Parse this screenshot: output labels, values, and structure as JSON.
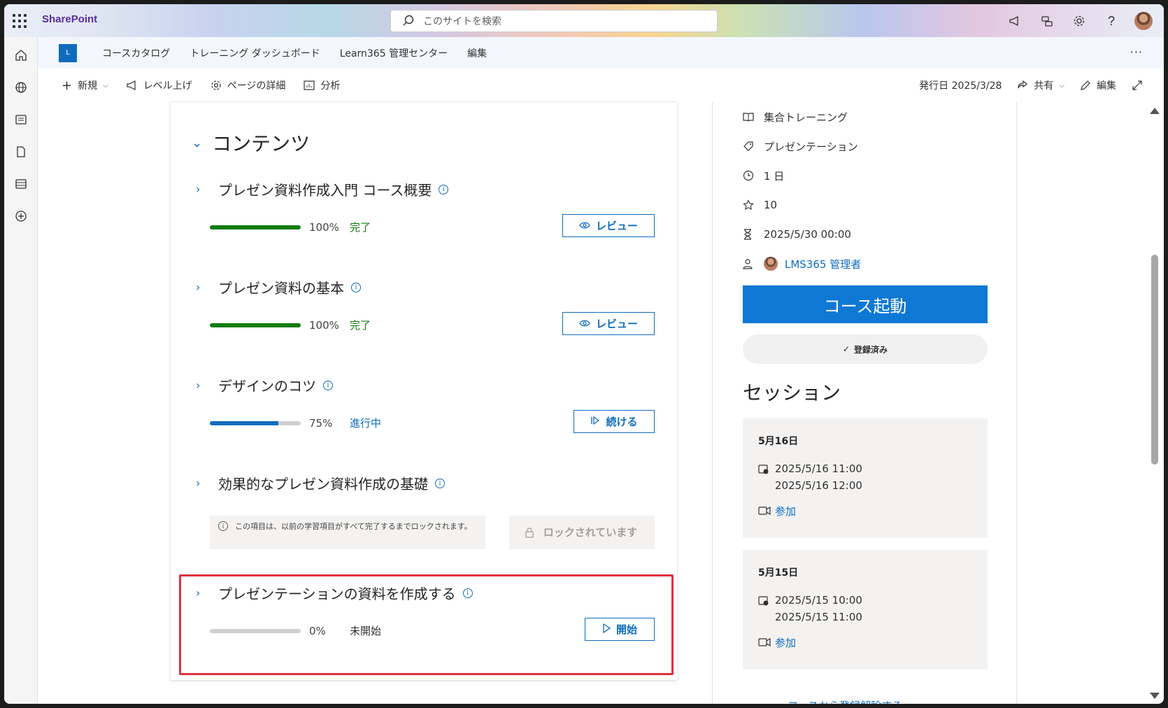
{
  "app": {
    "brand": "SharePoint",
    "search_placeholder": "このサイトを検索",
    "site_logo": "L"
  },
  "hub_nav": {
    "items": [
      "コースカタログ",
      "トレーニング ダッシュボード",
      "Learn365 管理センター",
      "編集"
    ],
    "more": "···"
  },
  "command_bar": {
    "new": "新規",
    "promote": "レベル上げ",
    "page_details": "ページの詳細",
    "analytics": "分析",
    "published": "発行日 2025/3/28",
    "share": "共有",
    "edit": "編集"
  },
  "contents": {
    "title": "コンテンツ",
    "modules": [
      {
        "title": "プレゼン資料作成入門 コース概要",
        "percent": "100%",
        "status": "完了",
        "progress": 1.0,
        "action": "レビュー",
        "status_color": "#107c10",
        "bar_color": "#107c10"
      },
      {
        "title": "プレゼン資料の基本",
        "percent": "100%",
        "status": "完了",
        "progress": 1.0,
        "action": "レビュー",
        "status_color": "#107c10",
        "bar_color": "#107c10"
      },
      {
        "title": "デザインのコツ",
        "percent": "75%",
        "status": "進行中",
        "progress": 0.75,
        "action": "続ける",
        "status_color": "#0f6cbd",
        "bar_color": "#0f6cbd"
      },
      {
        "title": "効果的なプレゼン資料作成の基礎",
        "lock_note": "この項目は、以前の学習項目がすべて完了するまでロックされます。",
        "lock_label": "ロックされています"
      },
      {
        "title": "プレゼンテーションの資料を作成する",
        "percent": "0%",
        "status": "未開始",
        "progress": 0.0,
        "action": "開始",
        "status_color": "#323130",
        "bar_color": "#c8c6c4"
      }
    ]
  },
  "course_info": {
    "type": "集合トレーニング",
    "tag": "プレゼンテーション",
    "duration": "1 日",
    "points": "10",
    "deadline": "2025/5/30 00:00",
    "owner": "LMS365 管理者",
    "launch": "コース起動",
    "enrolled": "登録済み"
  },
  "sessions": {
    "title": "セッション",
    "items": [
      {
        "date": "5月16日",
        "start": "2025/5/16 11:00",
        "end": "2025/5/16 12:00",
        "join": "参加"
      },
      {
        "date": "5月15日",
        "start": "2025/5/15 10:00",
        "end": "2025/5/15 11:00",
        "join": "参加"
      }
    ],
    "unenroll": "コースから登録解除する"
  }
}
